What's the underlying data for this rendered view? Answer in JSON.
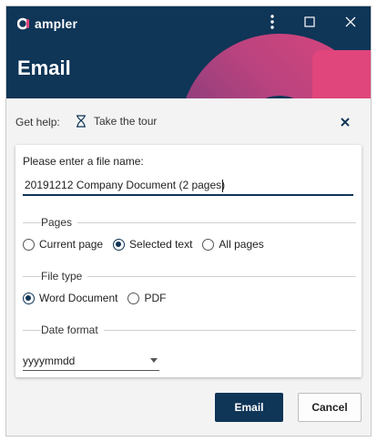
{
  "app": {
    "brand_name": "ampler",
    "dialog_title": "Email",
    "colors": {
      "primary": "#0f3557",
      "accent_pink": "#e0457b",
      "accent_purple": "#7a3f7e"
    }
  },
  "window_controls": {
    "menu_icon": "vertical-ellipsis-icon",
    "maximize_icon": "square-icon",
    "close_icon": "close-icon"
  },
  "help": {
    "label": "Get help:",
    "tour_label": "Take the tour",
    "tour_icon": "hourglass-icon",
    "close_icon": "close-icon"
  },
  "form": {
    "file_name_label": "Please enter a file name:",
    "file_name_value": "20191212 Company Document (2 pages)",
    "pages": {
      "title": "Pages",
      "options": [
        "Current page",
        "Selected text",
        "All pages"
      ],
      "selected": "Selected text"
    },
    "file_type": {
      "title": "File type",
      "options": [
        "Word Document",
        "PDF"
      ],
      "selected": "Word Document"
    },
    "date_format": {
      "title": "Date format",
      "value": "yyyymmdd"
    }
  },
  "actions": {
    "primary": "Email",
    "cancel": "Cancel"
  }
}
